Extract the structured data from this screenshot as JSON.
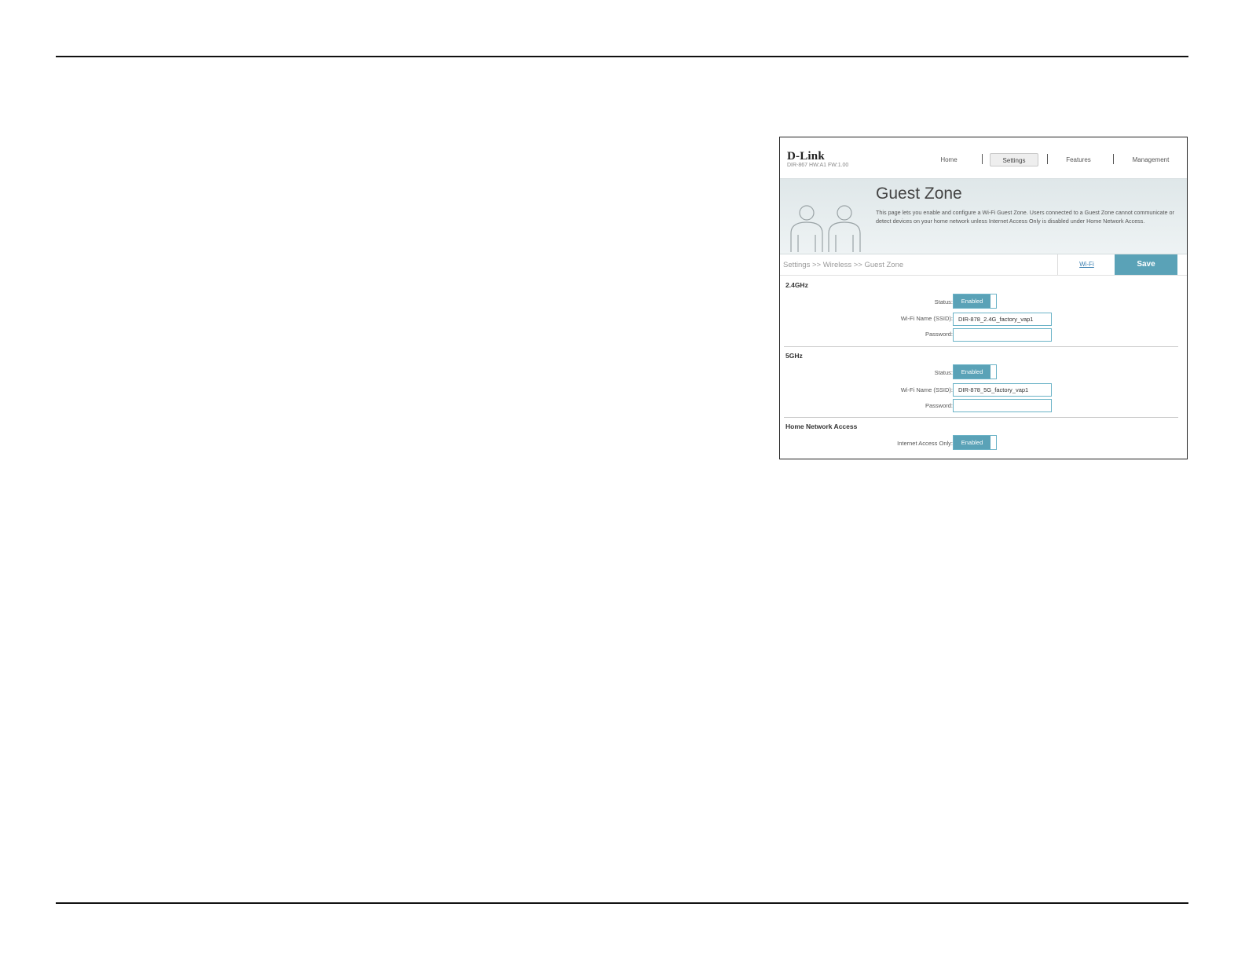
{
  "router": {
    "brand": "D-Link",
    "model_info": "DIR-867 HW:A1 FW:1.00",
    "nav": [
      "Home",
      "Settings",
      "Features",
      "Management"
    ],
    "active_nav": "Settings",
    "page_title": "Guest Zone",
    "description": "This page lets you enable and configure a Wi-Fi Guest Zone. Users connected to a Guest Zone cannot communicate or detect devices on your home network unless Internet Access Only is disabled under Home Network Access.",
    "breadcrumb": "Settings >> Wireless >> Guest Zone",
    "wifi_link": "Wi-Fi",
    "save_label": "Save",
    "band_24": {
      "title": "2.4GHz",
      "status_label": "Status:",
      "status_value": "Enabled",
      "ssid_label": "Wi-Fi Name (SSID):",
      "ssid_value": "DIR-878_2.4G_factory_vap1",
      "password_label": "Password:",
      "password_value": ""
    },
    "band_5": {
      "title": "5GHz",
      "status_label": "Status:",
      "status_value": "Enabled",
      "ssid_label": "Wi-Fi Name (SSID):",
      "ssid_value": "DIR-878_5G_factory_vap1",
      "password_label": "Password:",
      "password_value": ""
    },
    "home_access": {
      "title": "Home Network Access",
      "label": "Internet Access Only:",
      "value": "Enabled"
    }
  },
  "colors": {
    "accent": "#5aa2b7",
    "link": "#3a7fb1"
  }
}
